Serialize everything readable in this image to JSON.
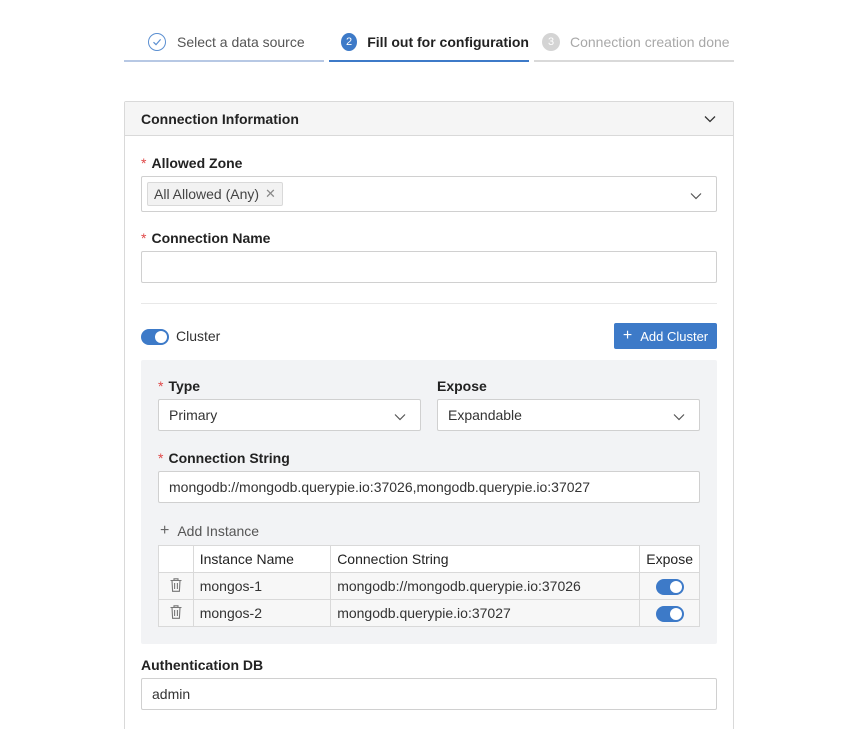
{
  "steps": [
    {
      "number": "1",
      "label": "Select a data source",
      "state": "done"
    },
    {
      "number": "2",
      "label": "Fill out for configuration",
      "state": "active"
    },
    {
      "number": "3",
      "label": "Connection creation done",
      "state": "inactive"
    }
  ],
  "panel": {
    "title": "Connection Information",
    "chevron_icon": "chevron-down-icon"
  },
  "form": {
    "required_mark": "*",
    "allowed_zone": {
      "label": "Allowed Zone",
      "tag": "All Allowed (Any)",
      "tag_close": "✕"
    },
    "connection_name": {
      "label": "Connection Name",
      "value": ""
    },
    "cluster": {
      "label": "Cluster",
      "enabled": true
    },
    "add_cluster_button": "Add Cluster",
    "type": {
      "label": "Type",
      "value": "Primary"
    },
    "expose": {
      "label": "Expose",
      "value": "Expandable"
    },
    "connection_string": {
      "label": "Connection String",
      "value": "mongodb://mongodb.querypie.io:37026,mongodb.querypie.io:37027"
    },
    "add_instance": "Add Instance",
    "instances_table": {
      "columns": [
        "",
        "Instance Name",
        "Connection String",
        "Expose"
      ],
      "rows": [
        {
          "name": "mongos-1",
          "connection_string": "mongodb://mongodb.querypie.io:37026",
          "expose": true
        },
        {
          "name": "mongos-2",
          "connection_string": "mongodb.querypie.io:37027",
          "expose": true
        }
      ]
    },
    "auth_db": {
      "label": "Authentication DB",
      "value": "admin"
    }
  },
  "colors": {
    "accent": "#3d7ac8",
    "required": "#e04848"
  }
}
